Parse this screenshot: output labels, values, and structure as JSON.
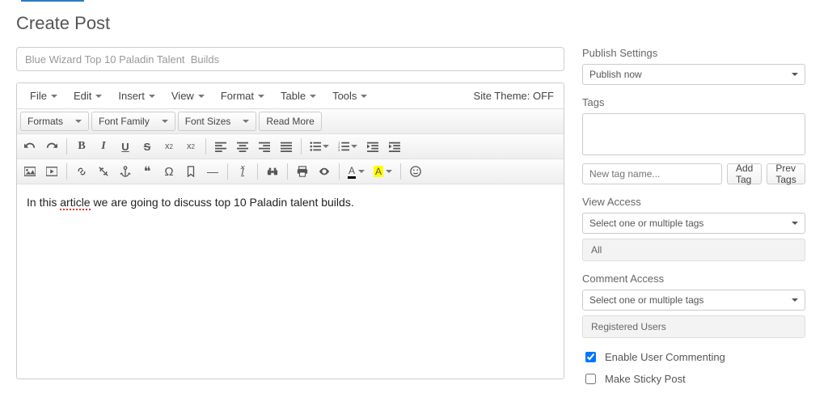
{
  "page": {
    "title": "Create Post"
  },
  "post": {
    "title_value": "Blue Wizard Top 10 Paladin Talent  Builds",
    "body_prefix": "In this ",
    "body_spell_word": "article",
    "body_suffix": " we are going to discuss top 10 Paladin talent builds."
  },
  "menubar": {
    "file": "File",
    "edit": "Edit",
    "insert": "Insert",
    "view": "View",
    "format": "Format",
    "table": "Table",
    "tools": "Tools",
    "theme_label": "Site Theme: ",
    "theme_state": "OFF"
  },
  "toolbar": {
    "formats": "Formats",
    "font_family": "Font Family",
    "font_sizes": "Font Sizes",
    "read_more": "Read More",
    "color_A": "A"
  },
  "sidebar": {
    "publish_label": "Publish Settings",
    "publish_value": "Publish now",
    "tags_label": "Tags",
    "new_tag_placeholder": "New tag name...",
    "add_tag": "Add Tag",
    "prev_tags": "Prev Tags",
    "view_access_label": "View Access",
    "view_access_value": "Select one or multiple tags",
    "view_access_all": "All",
    "comment_access_label": "Comment Access",
    "comment_access_value": "Select one or multiple tags",
    "comment_access_reg": "Registered Users",
    "enable_commenting": "Enable User Commenting",
    "sticky_post": "Make Sticky Post"
  }
}
